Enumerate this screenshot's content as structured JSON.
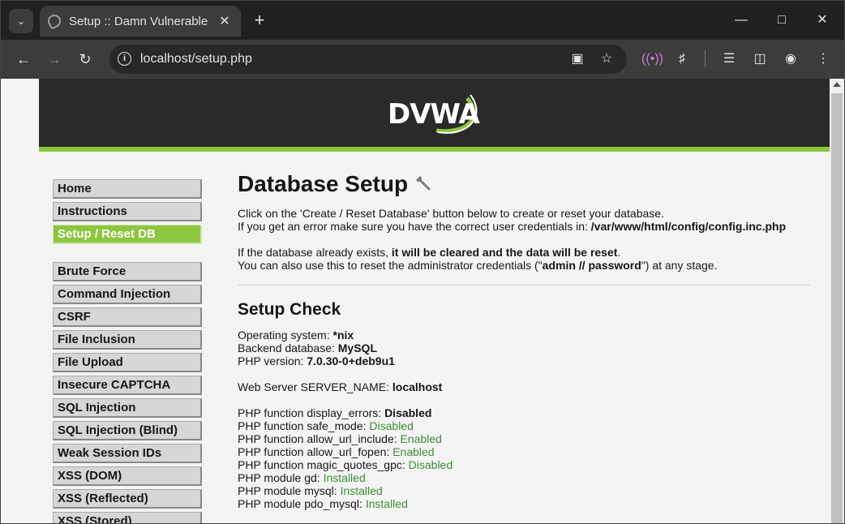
{
  "browser": {
    "tab_title": "Setup :: Damn Vulnerable",
    "url": "localhost/setup.php"
  },
  "header": {
    "logo_text": "DVWA"
  },
  "menu": {
    "items_top": [
      "Home",
      "Instructions",
      "Setup / Reset DB"
    ],
    "selected": "Setup / Reset DB",
    "items_vuln": [
      "Brute Force",
      "Command Injection",
      "CSRF",
      "File Inclusion",
      "File Upload",
      "Insecure CAPTCHA",
      "SQL Injection",
      "SQL Injection (Blind)",
      "Weak Session IDs",
      "XSS (DOM)",
      "XSS (Reflected)",
      "XSS (Stored)"
    ]
  },
  "main": {
    "title": "Database Setup",
    "intro_line1": "Click on the 'Create / Reset Database' button below to create or reset your database.",
    "intro_line2_prefix": "If you get an error make sure you have the correct user credentials in: ",
    "config_path": "/var/www/html/config/config.inc.php",
    "exists_prefix": "If the database already exists, ",
    "exists_bold": "it will be cleared and the data will be reset",
    "exists_suffix": ".",
    "reset_prefix": "You can also use this to reset the administrator credentials (\"",
    "reset_creds": "admin // password",
    "reset_suffix": "\") at any stage.",
    "check_title": "Setup Check",
    "os_label": "Operating system: ",
    "os_value": "*nix",
    "db_label": "Backend database: ",
    "db_value": "MySQL",
    "php_label": "PHP version: ",
    "php_value": "7.0.30-0+deb9u1",
    "server_label": "Web Server SERVER_NAME: ",
    "server_value": "localhost",
    "display_errors_label": "PHP function display_errors: ",
    "display_errors_value": "Disabled",
    "checks": [
      {
        "label": "PHP function safe_mode: ",
        "value": "Disabled"
      },
      {
        "label": "PHP function allow_url_include: ",
        "value": "Enabled"
      },
      {
        "label": "PHP function allow_url_fopen: ",
        "value": "Enabled"
      },
      {
        "label": "PHP function magic_quotes_gpc: ",
        "value": "Disabled"
      },
      {
        "label": "PHP module gd: ",
        "value": "Installed"
      },
      {
        "label": "PHP module mysql: ",
        "value": "Installed"
      },
      {
        "label": "PHP module pdo_mysql: ",
        "value": "Installed"
      }
    ]
  },
  "colors": {
    "accent": "#8dc63f",
    "ok": "#3d8b37",
    "header_bg": "#2a2a2a"
  }
}
